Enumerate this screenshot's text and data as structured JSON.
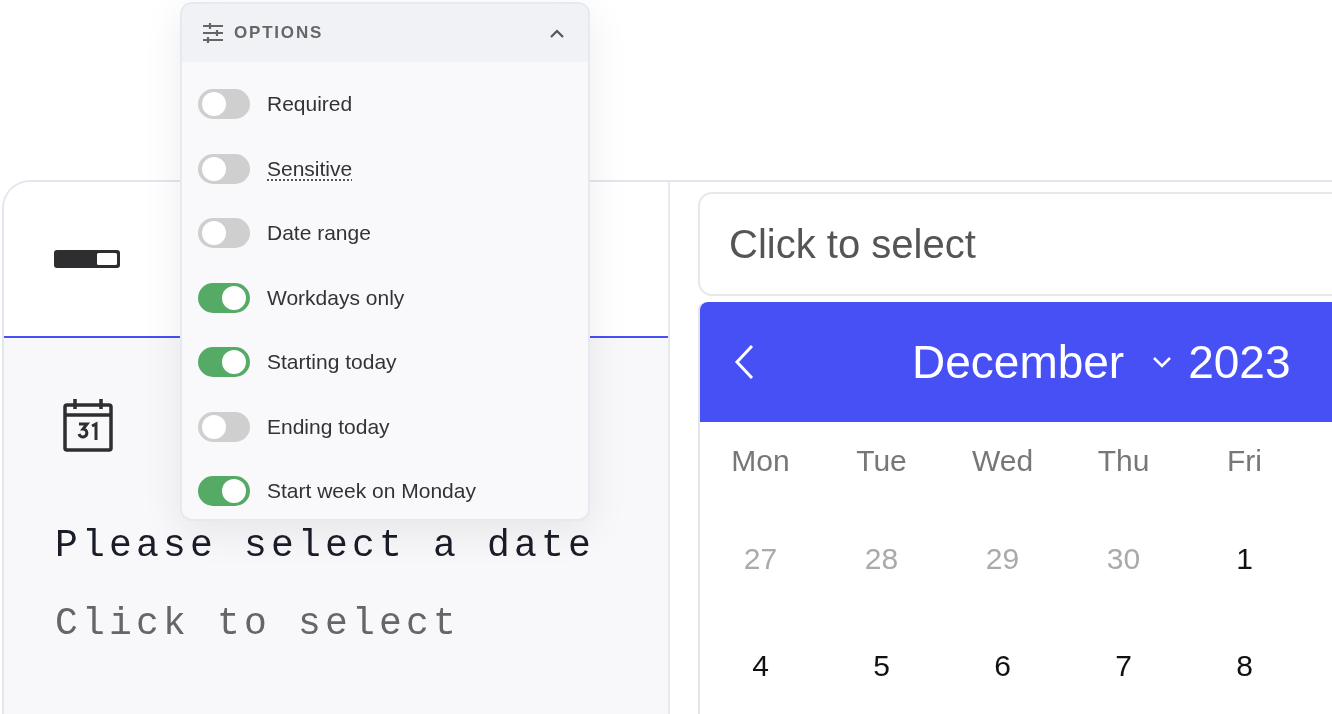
{
  "options": {
    "title": "OPTIONS",
    "expanded": true,
    "items": [
      {
        "label": "Required",
        "on": false,
        "has_tooltip": false
      },
      {
        "label": "Sensitive",
        "on": false,
        "has_tooltip": true
      },
      {
        "label": "Date range",
        "on": false,
        "has_tooltip": false
      },
      {
        "label": "Workdays only",
        "on": true,
        "has_tooltip": false
      },
      {
        "label": "Starting today",
        "on": true,
        "has_tooltip": false
      },
      {
        "label": "Ending today",
        "on": false,
        "has_tooltip": false
      },
      {
        "label": "Start week on Monday",
        "on": true,
        "has_tooltip": false
      }
    ]
  },
  "preview": {
    "heading": "Please select a date",
    "hint": "Click to select"
  },
  "date_field": {
    "placeholder": "Click to select"
  },
  "calendar": {
    "month": "December",
    "year": "2023",
    "weekdays": [
      "Mon",
      "Tue",
      "Wed",
      "Thu",
      "Fri"
    ],
    "weeks": [
      [
        {
          "day": "27",
          "muted": true
        },
        {
          "day": "28",
          "muted": true
        },
        {
          "day": "29",
          "muted": true
        },
        {
          "day": "30",
          "muted": true
        },
        {
          "day": "1",
          "muted": false
        }
      ],
      [
        {
          "day": "4",
          "muted": false
        },
        {
          "day": "5",
          "muted": false
        },
        {
          "day": "6",
          "muted": false
        },
        {
          "day": "7",
          "muted": false
        },
        {
          "day": "8",
          "muted": false
        }
      ]
    ]
  }
}
